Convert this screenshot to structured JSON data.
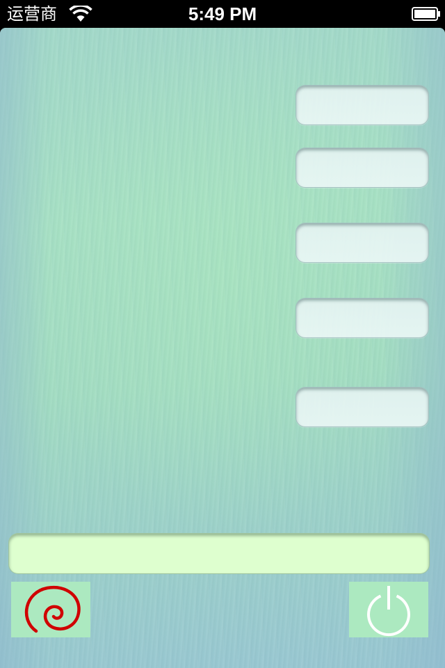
{
  "status_bar": {
    "carrier": "运营商",
    "time": "5:49 PM",
    "wifi_icon": "wifi-icon",
    "battery_icon": "battery-icon",
    "battery_level": 1.0
  },
  "fields": [
    {
      "name": "input-field-1",
      "value": ""
    },
    {
      "name": "input-field-2",
      "value": ""
    },
    {
      "name": "input-field-3",
      "value": ""
    },
    {
      "name": "input-field-4",
      "value": ""
    },
    {
      "name": "input-field-5",
      "value": ""
    }
  ],
  "bottom_bar": {
    "message_field_value": "",
    "left_button_icon": "swirl-logo-icon",
    "right_button_icon": "power-icon"
  },
  "colors": {
    "status_bar_bg": "#000000",
    "background_main": "#a6e0c4",
    "background_edge": "#98c6d2",
    "field_bg": "#e4f3f1",
    "message_field_bg": "#deffcf",
    "tile_button_bg": "#ace9c0",
    "swirl_color": "#d00000",
    "power_icon_color": "#ffffff"
  }
}
